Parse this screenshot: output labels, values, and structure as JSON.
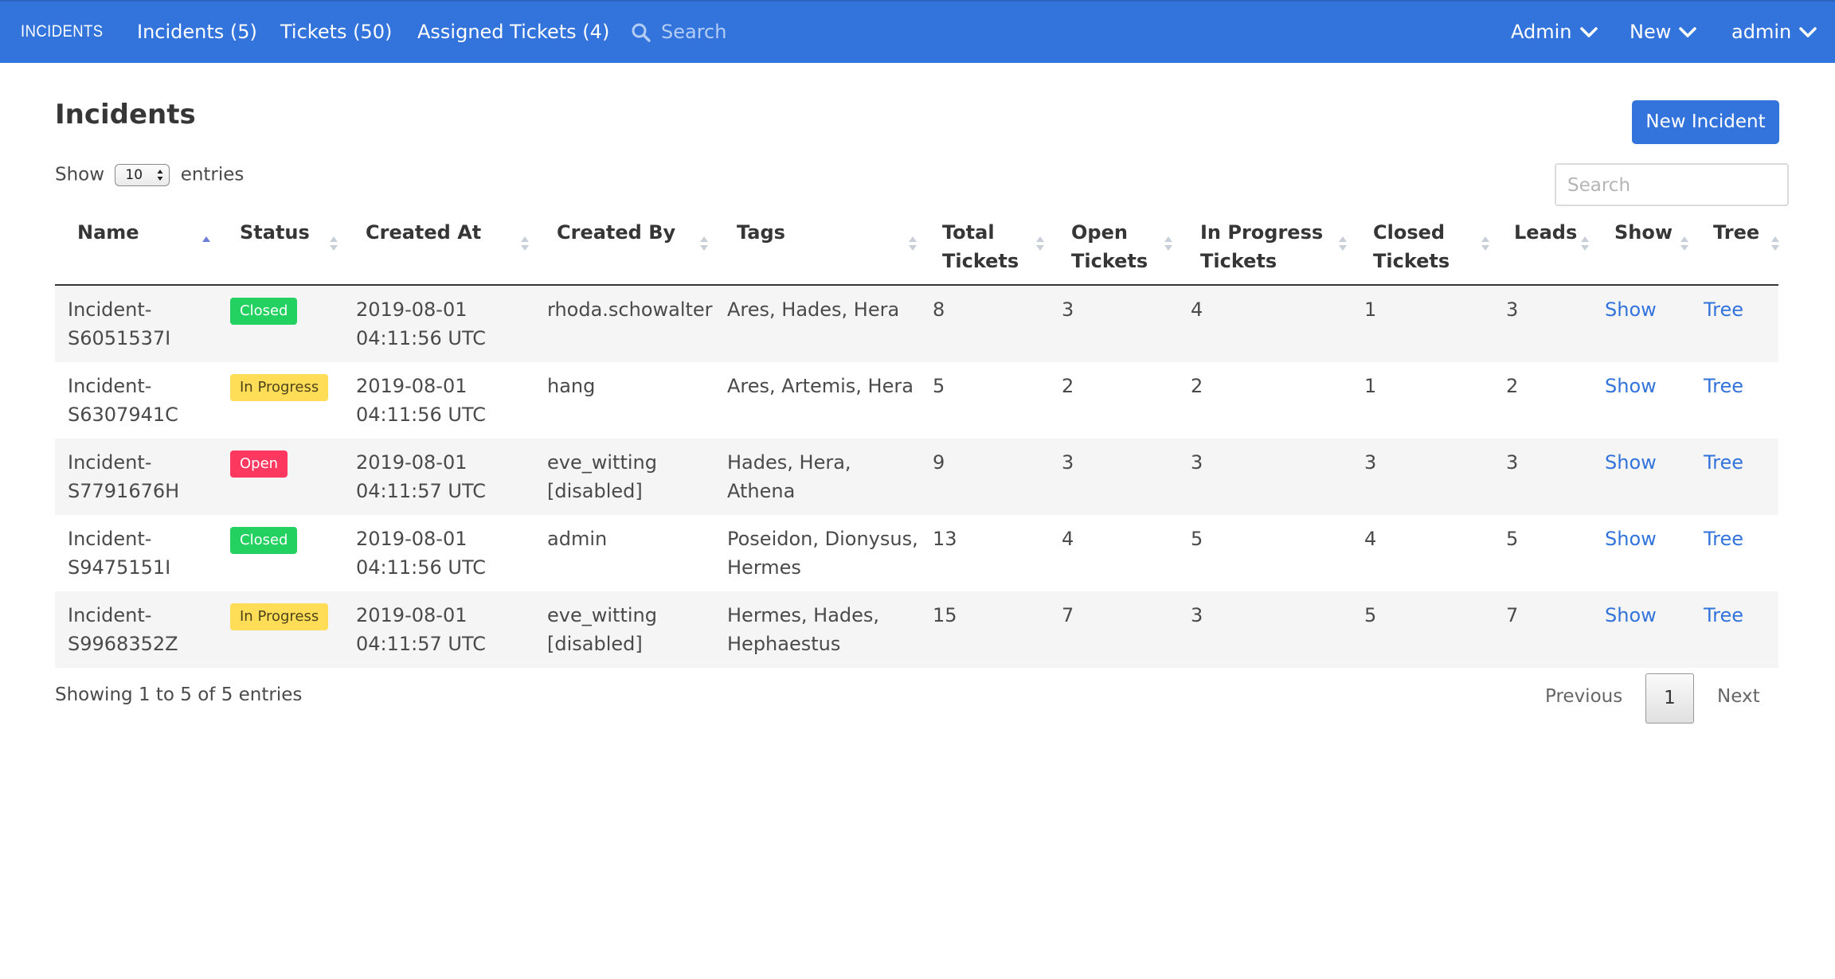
{
  "navbar": {
    "brand": "INCIDENTS",
    "links": [
      "Incidents (5)",
      "Tickets (50)",
      "Assigned Tickets (4)"
    ],
    "search_placeholder": "Search",
    "dropdowns": [
      "Admin",
      "New",
      "admin"
    ],
    "background_color": "#3273dc"
  },
  "page": {
    "title": "Incidents",
    "new_button": "New Incident",
    "show_label": "Show",
    "entries_label": "entries",
    "entries_value": "10",
    "search_placeholder": "Search"
  },
  "table": {
    "columns": [
      {
        "label": "Name",
        "sort": "asc"
      },
      {
        "label": "Status",
        "sort": "none"
      },
      {
        "label": "Created At",
        "sort": "none"
      },
      {
        "label": "Created By",
        "sort": "none"
      },
      {
        "label": "Tags",
        "sort": "none"
      },
      {
        "label": "Total Tickets",
        "sort": "none"
      },
      {
        "label": "Open Tickets",
        "sort": "none"
      },
      {
        "label": "In Progress Tickets",
        "sort": "none"
      },
      {
        "label": "Closed Tickets",
        "sort": "none"
      },
      {
        "label": "Leads",
        "sort": "none"
      },
      {
        "label": "Show",
        "sort": "none"
      },
      {
        "label": "Tree",
        "sort": "none"
      }
    ],
    "rows": [
      {
        "name": "Incident-S6051537I",
        "status": "Closed",
        "status_kind": "closed",
        "created_at": "2019-08-01 04:11:56 UTC",
        "created_by": "rhoda.schowalter",
        "tags": "Ares, Hades, Hera",
        "total": "8",
        "open": "3",
        "in_progress": "4",
        "closed": "1",
        "leads": "3",
        "show": "Show",
        "tree": "Tree"
      },
      {
        "name": "Incident-S6307941C",
        "status": "In Progress",
        "status_kind": "inprogress",
        "created_at": "2019-08-01 04:11:56 UTC",
        "created_by": "hang",
        "tags": "Ares, Artemis, Hera",
        "total": "5",
        "open": "2",
        "in_progress": "2",
        "closed": "1",
        "leads": "2",
        "show": "Show",
        "tree": "Tree"
      },
      {
        "name": "Incident-S7791676H",
        "status": "Open",
        "status_kind": "open",
        "created_at": "2019-08-01 04:11:57 UTC",
        "created_by": "eve_witting [disabled]",
        "tags": "Hades, Hera, Athena",
        "total": "9",
        "open": "3",
        "in_progress": "3",
        "closed": "3",
        "leads": "3",
        "show": "Show",
        "tree": "Tree"
      },
      {
        "name": "Incident-S9475151I",
        "status": "Closed",
        "status_kind": "closed",
        "created_at": "2019-08-01 04:11:56 UTC",
        "created_by": "admin",
        "tags": "Poseidon, Dionysus, Hermes",
        "total": "13",
        "open": "4",
        "in_progress": "5",
        "closed": "4",
        "leads": "5",
        "show": "Show",
        "tree": "Tree"
      },
      {
        "name": "Incident-S9968352Z",
        "status": "In Progress",
        "status_kind": "inprogress",
        "created_at": "2019-08-01 04:11:57 UTC",
        "created_by": "eve_witting [disabled]",
        "tags": "Hermes, Hades, Hephaestus",
        "total": "15",
        "open": "7",
        "in_progress": "3",
        "closed": "5",
        "leads": "7",
        "show": "Show",
        "tree": "Tree"
      }
    ]
  },
  "footer": {
    "info": "Showing 1 to 5 of 5 entries",
    "previous": "Previous",
    "current_page": "1",
    "next": "Next"
  },
  "icons": {
    "search": "search-icon",
    "dropdown": "chevron-down-icon",
    "sort": "sort-icon"
  },
  "colors": {
    "link": "#3273dc",
    "closed": "#23d160",
    "in_progress": "#ffdd57",
    "open": "#ff3860",
    "stripe": "#f5f5f5"
  }
}
